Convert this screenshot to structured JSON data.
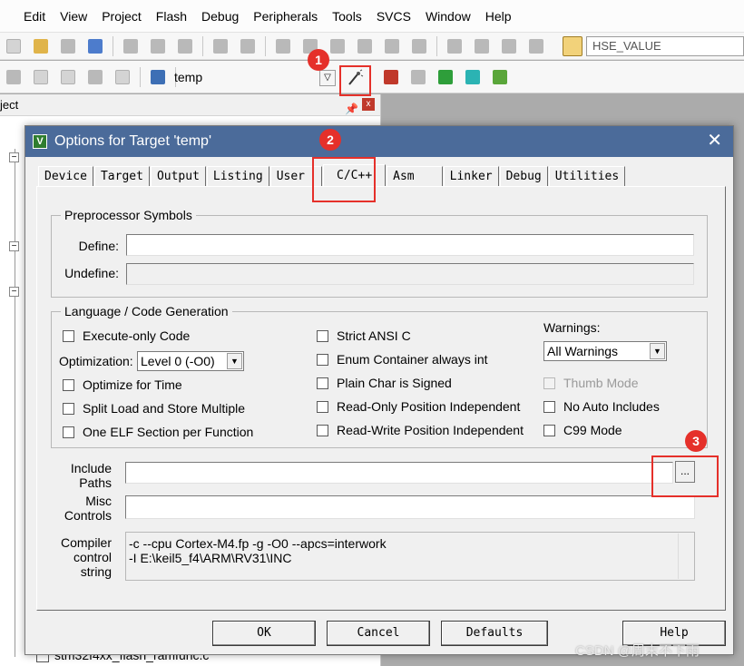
{
  "menubar": {
    "items": [
      "Edit",
      "View",
      "Project",
      "Flash",
      "Debug",
      "Peripherals",
      "Tools",
      "SVCS",
      "Window",
      "Help"
    ]
  },
  "toolbar1": {
    "define_combo": "HSE_VALUE",
    "define_icon": "find-in-files-icon"
  },
  "toolbar2": {
    "target_combo": "temp",
    "options_button_icon": "magic-wand-icon",
    "load_icon": "load-icon"
  },
  "project_panel": {
    "header": "ject",
    "bottom_file": "stm32f4xx_flash_ramfunc.c"
  },
  "dialog": {
    "title": "Options for Target 'temp'",
    "close_glyph": "✕",
    "icon_letter": "V",
    "tabs": [
      "Device",
      "Target",
      "Output",
      "Listing",
      "User",
      "C/C++",
      "Asm",
      "Linker",
      "Debug",
      "Utilities"
    ],
    "active_tab": "C/C++",
    "preprocessor": {
      "legend": "Preprocessor Symbols",
      "define_label": "Define:",
      "define_value": "",
      "undefine_label": "Undefine:",
      "undefine_value": ""
    },
    "language": {
      "legend": "Language / Code Generation",
      "execute_only": "Execute-only Code",
      "optimization_label": "Optimization:",
      "optimization_value": "Level 0 (-O0)",
      "optimize_time": "Optimize for Time",
      "split_load": "Split Load and Store Multiple",
      "one_elf": "One ELF Section per Function",
      "strict_ansi": "Strict ANSI C",
      "enum_container": "Enum Container always int",
      "plain_char": "Plain Char is Signed",
      "ropi": "Read-Only Position Independent",
      "rwpi": "Read-Write Position Independent",
      "warnings_label": "Warnings:",
      "warnings_value": "All Warnings",
      "thumb_mode": "Thumb Mode",
      "no_auto_includes": "No Auto Includes",
      "c99_mode": "C99 Mode"
    },
    "include": {
      "label_line1": "Include",
      "label_line2": "Paths",
      "value": "",
      "browse_label": "..."
    },
    "misc": {
      "label_line1": "Misc",
      "label_line2": "Controls",
      "value": ""
    },
    "compiler": {
      "label_line1": "Compiler",
      "label_line2": "control",
      "label_line3": "string",
      "line1": "-c --cpu Cortex-M4.fp -g -O0 --apcs=interwork",
      "line2": "-I E:\\keil5_f4\\ARM\\RV31\\INC"
    },
    "buttons": {
      "ok": "OK",
      "cancel": "Cancel",
      "defaults": "Defaults",
      "help": "Help"
    }
  },
  "callouts": [
    "1",
    "2",
    "3"
  ],
  "watermark": "CSDN @周末不下雨",
  "colors": {
    "callout_red": "#e5302a",
    "title_bar": "#4b6b9a"
  }
}
